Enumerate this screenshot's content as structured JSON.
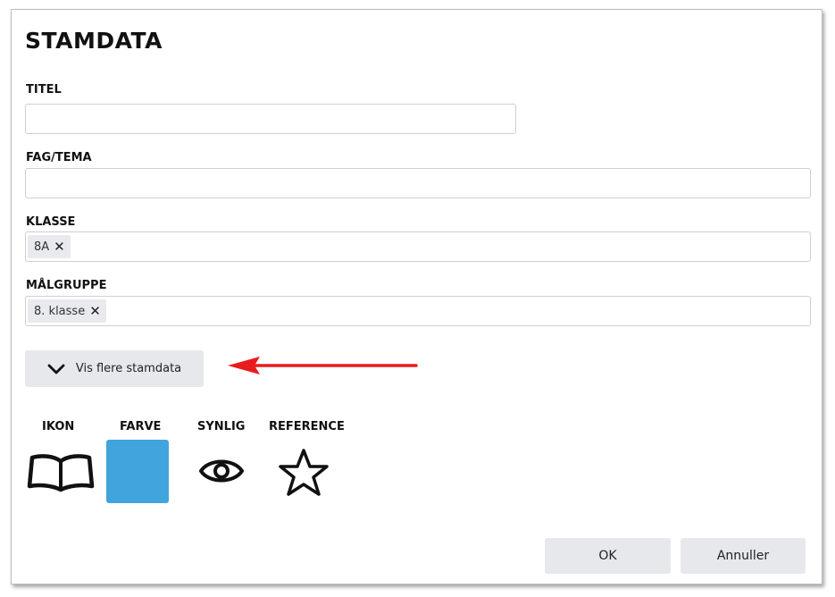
{
  "dialog": {
    "title": "STAMDATA"
  },
  "fields": {
    "titel": {
      "label": "TITEL",
      "value": ""
    },
    "fag_tema": {
      "label": "FAG/TEMA",
      "value": ""
    },
    "klasse": {
      "label": "KLASSE",
      "chips": [
        "8A"
      ]
    },
    "maalgruppe": {
      "label": "MÅLGRUPPE",
      "chips": [
        "8. klasse"
      ]
    }
  },
  "more_button": {
    "label": "Vis flere stamdata",
    "icon": "chevron-down-icon"
  },
  "annotation": {
    "arrow_color": "#e81c1c"
  },
  "properties": {
    "ikon": {
      "label": "IKON",
      "icon": "open-book-icon"
    },
    "farve": {
      "label": "FARVE",
      "color": "#42a4dc"
    },
    "synlig": {
      "label": "SYNLIG",
      "icon": "eye-icon"
    },
    "reference": {
      "label": "REFERENCE",
      "icon": "star-outline-icon"
    }
  },
  "footer": {
    "ok_label": "OK",
    "cancel_label": "Annuller"
  }
}
